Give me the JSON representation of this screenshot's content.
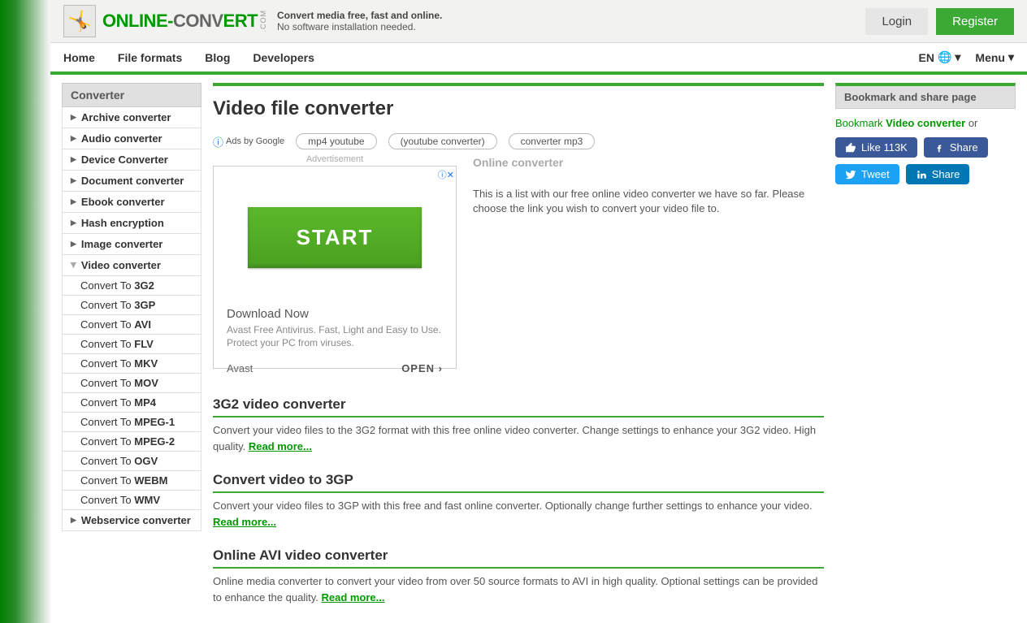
{
  "header": {
    "logo_a": "ONLINE-",
    "logo_b": "CONV",
    "logo_c": "ERT",
    "logo_sub": ".COM",
    "tagline1": "Convert media free, fast and online.",
    "tagline2": "No software installation needed.",
    "login": "Login",
    "register": "Register"
  },
  "nav": {
    "items": [
      "Home",
      "File formats",
      "Blog",
      "Developers"
    ],
    "lang": "EN",
    "menu": "Menu"
  },
  "sidebar": {
    "header": "Converter",
    "items": [
      "Archive converter",
      "Audio converter",
      "Device Converter",
      "Document converter",
      "Ebook converter",
      "Hash encryption",
      "Image converter",
      "Video converter",
      "Webservice converter"
    ],
    "subs": [
      {
        "pre": "Convert To ",
        "fmt": "3G2"
      },
      {
        "pre": "Convert To ",
        "fmt": "3GP"
      },
      {
        "pre": "Convert To ",
        "fmt": "AVI"
      },
      {
        "pre": "Convert To ",
        "fmt": "FLV"
      },
      {
        "pre": "Convert To ",
        "fmt": "MKV"
      },
      {
        "pre": "Convert To ",
        "fmt": "MOV"
      },
      {
        "pre": "Convert To ",
        "fmt": "MP4"
      },
      {
        "pre": "Convert To ",
        "fmt": "MPEG-1"
      },
      {
        "pre": "Convert To ",
        "fmt": "MPEG-2"
      },
      {
        "pre": "Convert To ",
        "fmt": "OGV"
      },
      {
        "pre": "Convert To ",
        "fmt": "WEBM"
      },
      {
        "pre": "Convert To ",
        "fmt": "WMV"
      }
    ]
  },
  "main": {
    "title": "Video file converter",
    "ads_by": "Ads by Google",
    "ad_pills": [
      "mp4 youtube",
      "(youtube converter)",
      "converter mp3"
    ],
    "ad_label": "Advertisement",
    "ad_start": "START",
    "ad_dl": "Download Now",
    "ad_desc": "Avast Free Antivirus. Fast, Light and Easy to Use. Protect your PC from viruses.",
    "ad_brand": "Avast",
    "ad_open": "OPEN",
    "intro_h": "Online converter",
    "intro_p": "This is a list with our free online video converter we have so far. Please choose the link you wish to convert your video file to.",
    "readmore": "Read more...",
    "convs": [
      {
        "h": "3G2 video converter",
        "p": "Convert your video files to the 3G2 format with this free online video converter. Change settings to enhance your 3G2 video. High quality. "
      },
      {
        "h": "Convert video to 3GP",
        "p": "Convert your video files to 3GP with this free and fast online converter. Optionally change further settings to enhance your video. "
      },
      {
        "h": "Online AVI video converter",
        "p": "Online media converter to convert your video from over 50 source formats to AVI in high quality. Optional settings can be provided to enhance the quality. "
      }
    ]
  },
  "right": {
    "header": "Bookmark and share page",
    "bookmark": "Bookmark",
    "vc": "Video converter",
    "or": "or",
    "like": "Like 113K",
    "share": "Share",
    "tweet": "Tweet",
    "share2": "Share"
  }
}
